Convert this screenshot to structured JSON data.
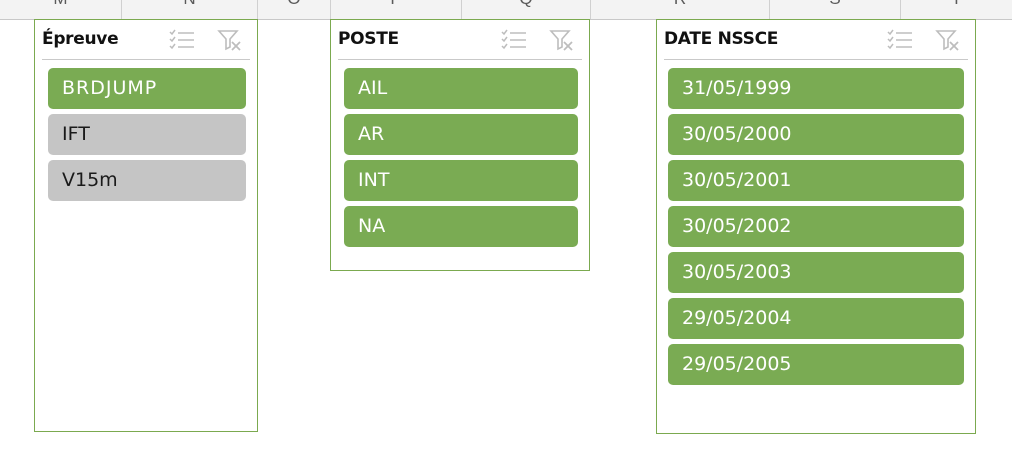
{
  "columns": [
    "M",
    "N",
    "O",
    "P",
    "Q",
    "R",
    "S",
    "T"
  ],
  "colors": {
    "accent": "#7aab53",
    "border": "#7ba94f",
    "unselected": "#c5c5c5"
  },
  "slicers": [
    {
      "title": "Épreuve",
      "items": [
        {
          "label": "BRDJUMP",
          "selected": true
        },
        {
          "label": "IFT",
          "selected": false
        },
        {
          "label": "V15m",
          "selected": false
        }
      ]
    },
    {
      "title": "POSTE",
      "items": [
        {
          "label": "AIL",
          "selected": true
        },
        {
          "label": "AR",
          "selected": true
        },
        {
          "label": "INT",
          "selected": true
        },
        {
          "label": "NA",
          "selected": true
        }
      ]
    },
    {
      "title": "DATE NSSCE",
      "items": [
        {
          "label": "31/05/1999",
          "selected": true
        },
        {
          "label": "30/05/2000",
          "selected": true
        },
        {
          "label": "30/05/2001",
          "selected": true
        },
        {
          "label": "30/05/2002",
          "selected": true
        },
        {
          "label": "30/05/2003",
          "selected": true
        },
        {
          "label": "29/05/2004",
          "selected": true
        },
        {
          "label": "29/05/2005",
          "selected": true
        }
      ]
    }
  ],
  "icons": {
    "multi_select": "multi-select-icon",
    "clear_filter": "clear-filter-icon"
  }
}
